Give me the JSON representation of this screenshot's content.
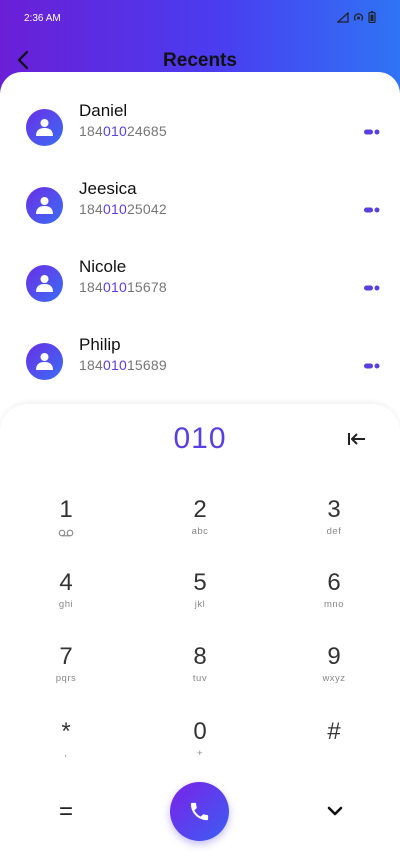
{
  "status_bar": {
    "time": "2:36 AM"
  },
  "header": {
    "title": "Recents"
  },
  "contacts": [
    {
      "name": "Daniel",
      "number_prefix": "184",
      "number_match": "010",
      "number_suffix": "24685"
    },
    {
      "name": "Jeesica",
      "number_prefix": "184",
      "number_match": "010",
      "number_suffix": "25042"
    },
    {
      "name": "Nicole",
      "number_prefix": "184",
      "number_match": "010",
      "number_suffix": "15678"
    },
    {
      "name": "Philip",
      "number_prefix": "184",
      "number_match": "010",
      "number_suffix": "15689"
    }
  ],
  "dialer": {
    "input": "010",
    "keys": [
      {
        "digit": "1",
        "letters": ""
      },
      {
        "digit": "2",
        "letters": "abc"
      },
      {
        "digit": "3",
        "letters": "def"
      },
      {
        "digit": "4",
        "letters": "ghi"
      },
      {
        "digit": "5",
        "letters": "jkl"
      },
      {
        "digit": "6",
        "letters": "mno"
      },
      {
        "digit": "7",
        "letters": "pqrs"
      },
      {
        "digit": "8",
        "letters": "tuv"
      },
      {
        "digit": "9",
        "letters": "wxyz"
      },
      {
        "digit": "*",
        "letters": ","
      },
      {
        "digit": "0",
        "letters": "+"
      },
      {
        "digit": "#",
        "letters": ""
      }
    ],
    "bottom": {
      "left": "="
    }
  },
  "colors": {
    "accent": "#5a3fe0",
    "header_start": "#6a1fd6",
    "header_end": "#2f74f5"
  }
}
